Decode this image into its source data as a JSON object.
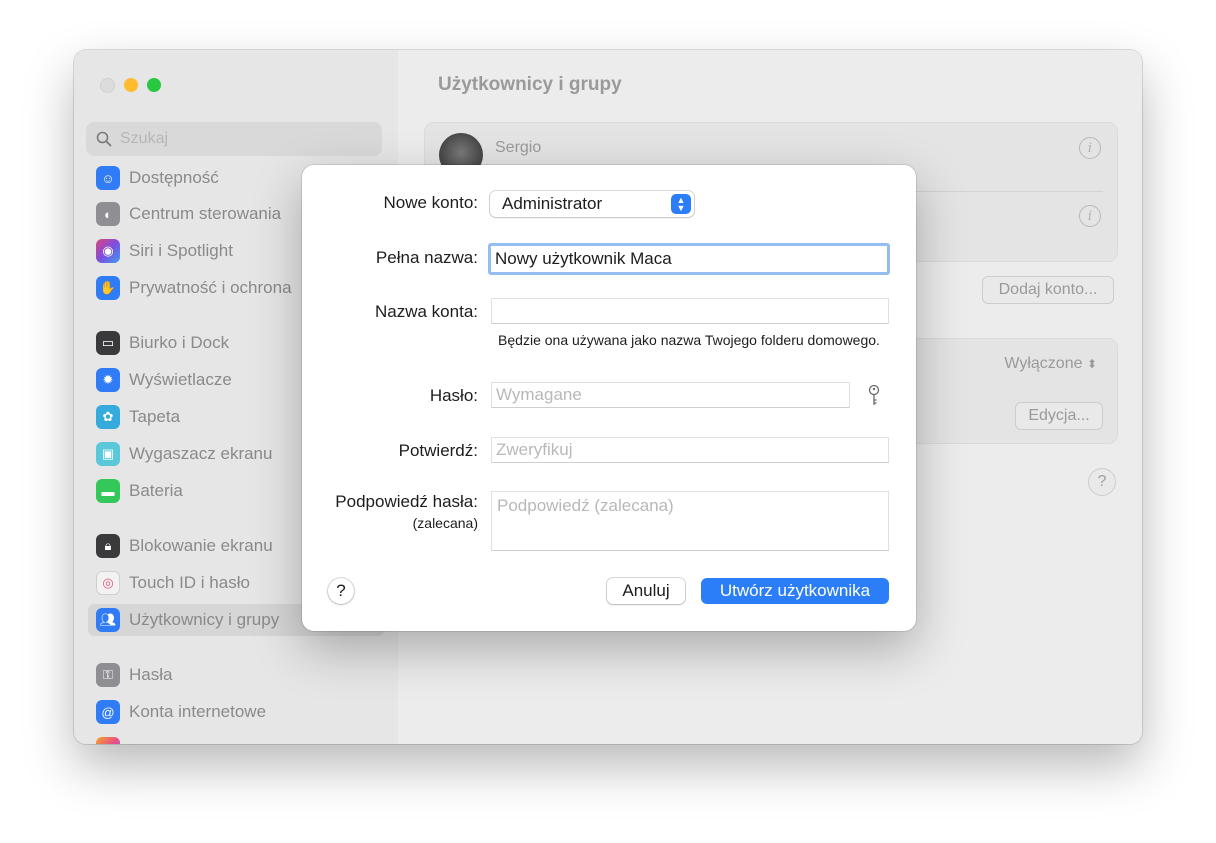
{
  "window": {
    "title": "Użytkownicy i grupy"
  },
  "sidebar": {
    "search_placeholder": "Szukaj",
    "items": [
      {
        "label": "Dostępność",
        "icon": "accessibility-icon",
        "color": "#2f7cf6"
      },
      {
        "label": "Centrum sterowania",
        "icon": "toggles-icon",
        "color": "#8e8e93"
      },
      {
        "label": "Siri i Spotlight",
        "icon": "siri-icon",
        "color": "#c248d6"
      },
      {
        "label": "Prywatność i ochrona",
        "icon": "hand-icon",
        "color": "#2f7cf6"
      },
      {
        "label": "Biurko i Dock",
        "icon": "dock-icon",
        "color": "#1d1d1f"
      },
      {
        "label": "Wyświetlacze",
        "icon": "sun-icon",
        "color": "#2f7cf6"
      },
      {
        "label": "Tapeta",
        "icon": "flower-icon",
        "color": "#35aadc"
      },
      {
        "label": "Wygaszacz ekranu",
        "icon": "screensaver-icon",
        "color": "#5ac8d8"
      },
      {
        "label": "Bateria",
        "icon": "battery-icon",
        "color": "#34c759"
      },
      {
        "label": "Blokowanie ekranu",
        "icon": "lock-icon",
        "color": "#1d1d1f"
      },
      {
        "label": "Touch ID i hasło",
        "icon": "fingerprint-icon",
        "color": "#ffffff"
      },
      {
        "label": "Użytkownicy i grupy",
        "icon": "users-icon",
        "color": "#2f7cf6"
      },
      {
        "label": "Hasła",
        "icon": "key-icon",
        "color": "#8e8e93"
      },
      {
        "label": "Konta internetowe",
        "icon": "at-icon",
        "color": "#2f7cf6"
      }
    ]
  },
  "main": {
    "user_name": "Sergio",
    "add_account_label": "Dodaj konto...",
    "auto_login_value": "Wyłączone",
    "edit_label": "Edycja...",
    "help_label": "?"
  },
  "dialog": {
    "new_account_label": "Nowe konto:",
    "account_type": "Administrator",
    "full_name_label": "Pełna nazwa:",
    "full_name_value": "Nowy użytkownik Maca",
    "account_name_label": "Nazwa konta:",
    "account_name_value": "",
    "account_name_note": "Będzie ona używana jako nazwa Twojego folderu domowego.",
    "password_label": "Hasło:",
    "password_placeholder": "Wymagane",
    "verify_label": "Potwierdź:",
    "verify_placeholder": "Zweryfikuj",
    "hint_label": "Podpowiedź hasła:",
    "hint_sublabel": "(zalecana)",
    "hint_placeholder": "Podpowiedź (zalecana)",
    "help_label": "?",
    "cancel_label": "Anuluj",
    "create_label": "Utwórz użytkownika"
  },
  "colors": {
    "accent": "#2b7ef7",
    "focus_ring": "#94bdf2"
  }
}
